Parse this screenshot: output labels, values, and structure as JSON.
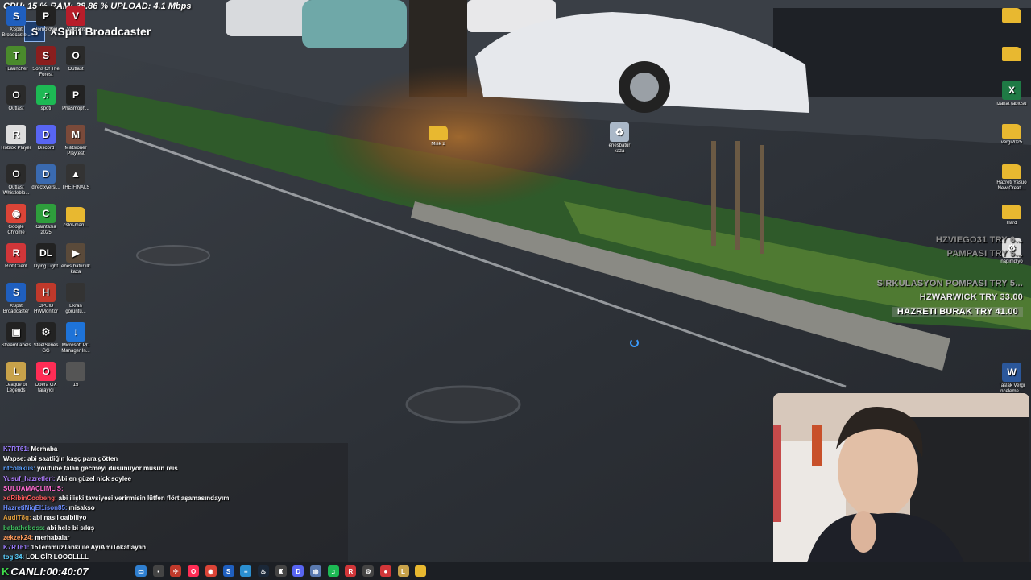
{
  "stats": {
    "text": "CPU: 15 % RAM: 38.86 % UPLOAD: 4.1 Mbps"
  },
  "broadcaster": {
    "logo": "S",
    "title": "XSplit Broadcaster"
  },
  "desktop_icons_left": [
    {
      "label": "XSplit Broadcaste...",
      "icon": "xsplit-icon",
      "color": "#1f5fbf",
      "glyph": "S"
    },
    {
      "label": "Pornofobia",
      "icon": "app-icon",
      "color": "#222222",
      "glyph": "P"
    },
    {
      "label": "Valorant",
      "icon": "valorant-icon",
      "color": "#b81d2a",
      "glyph": "V"
    },
    {
      "label": "TLauncher",
      "icon": "minecraft-icon",
      "color": "#4a8a2c",
      "glyph": "T"
    },
    {
      "label": "Sons Of The Forest",
      "icon": "game-icon",
      "color": "#8a1e1e",
      "glyph": "S"
    },
    {
      "label": "Outlast",
      "icon": "game-icon",
      "color": "#2a2a2a",
      "glyph": "O"
    },
    {
      "label": "Outlast",
      "icon": "game-icon",
      "color": "#2a2a2a",
      "glyph": "O"
    },
    {
      "label": "spoti",
      "icon": "spotify-icon",
      "color": "#1db954",
      "glyph": "♫"
    },
    {
      "label": "Phasmoph...",
      "icon": "phasmophobia-icon",
      "color": "#222222",
      "glyph": "P"
    },
    {
      "label": "Roblox Player",
      "icon": "roblox-icon",
      "color": "#dddddd",
      "glyph": "R"
    },
    {
      "label": "Discord",
      "icon": "discord-icon",
      "color": "#5865f2",
      "glyph": "D"
    },
    {
      "label": "Militsioner Playtest",
      "icon": "game-icon",
      "color": "#7a4a3a",
      "glyph": "M"
    },
    {
      "label": "Outlast Whistleblo...",
      "icon": "game-icon",
      "color": "#2a2a2a",
      "glyph": "O"
    },
    {
      "label": "directxversi...",
      "icon": "directx-icon",
      "color": "#3a6ab0",
      "glyph": "D"
    },
    {
      "label": "THE FINALS",
      "icon": "finals-icon",
      "color": "#333333",
      "glyph": "▲"
    },
    {
      "label": "Google Chrome",
      "icon": "chrome-icon",
      "color": "#db4437",
      "glyph": "◉"
    },
    {
      "label": "Camtasia 2025",
      "icon": "camtasia-icon",
      "color": "#2e9e3c",
      "glyph": "C"
    },
    {
      "label": "cslol-man...",
      "icon": "folder-icon",
      "color": "#e8b830",
      "glyph": ""
    },
    {
      "label": "Riot Client",
      "icon": "riot-icon",
      "color": "#d13639",
      "glyph": "R"
    },
    {
      "label": "Dying Light",
      "icon": "dyinglight-icon",
      "color": "#222222",
      "glyph": "DL"
    },
    {
      "label": "enes batur ilk kaza",
      "icon": "video-icon",
      "color": "#5a4a3a",
      "glyph": "▶"
    },
    {
      "label": "XSplit Broadcaster",
      "icon": "xsplit-icon",
      "color": "#1f5fbf",
      "glyph": "S"
    },
    {
      "label": "CPUID HWMonitor",
      "icon": "hwmonitor-icon",
      "color": "#c0392b",
      "glyph": "H"
    },
    {
      "label": "Ekran görüntü...",
      "icon": "image-icon",
      "color": "#333333",
      "glyph": ""
    },
    {
      "label": "StreamLabels",
      "icon": "streamlabels-icon",
      "color": "#222222",
      "glyph": "▣"
    },
    {
      "label": "SteelSeries GG",
      "icon": "steelseries-icon",
      "color": "#222222",
      "glyph": "⚙"
    },
    {
      "label": "Microsoft PC Manager In...",
      "icon": "download-icon",
      "color": "#1e73d8",
      "glyph": "↓"
    },
    {
      "label": "League of Legends",
      "icon": "lol-icon",
      "color": "#c8a24a",
      "glyph": "L"
    },
    {
      "label": "Opera GX tarayıcı",
      "icon": "opera-icon",
      "color": "#ff2d55",
      "glyph": "O"
    },
    {
      "label": "15",
      "icon": "image-icon",
      "color": "#555555",
      "glyph": ""
    }
  ],
  "desktop_icons_center": [
    {
      "label": "Misk 2",
      "icon": "folder-icon",
      "color": "#e8b830",
      "glyph": ""
    },
    {
      "label": "enesbatur kaza",
      "icon": "recycle-bin-icon",
      "color": "#aab8c8",
      "glyph": "♻"
    }
  ],
  "desktop_icons_right": [
    {
      "label": "",
      "icon": "folder-icon",
      "color": "#e8b830",
      "glyph": ""
    },
    {
      "label": "",
      "icon": "folder-icon",
      "color": "#e8b830",
      "glyph": ""
    },
    {
      "label": "izahat tablosu",
      "icon": "excel-icon",
      "color": "#1f7a45",
      "glyph": "X"
    },
    {
      "label": "vergi2025",
      "icon": "folder-icon",
      "color": "#e8b830",
      "glyph": ""
    },
    {
      "label": "Hazreti Yasuo New Creati...",
      "icon": "folder-icon",
      "color": "#e8b830",
      "glyph": ""
    },
    {
      "label": "Hard",
      "icon": "folder-icon",
      "color": "#e8b830",
      "glyph": ""
    },
    {
      "label": "napimdiyo",
      "icon": "app-icon",
      "color": "#dddddd",
      "glyph": "⚙"
    },
    {
      "label": "Taslak Vergi İnceleme ...",
      "icon": "word-icon",
      "color": "#2b579a",
      "glyph": "W"
    }
  ],
  "donations": [
    {
      "text": "HZVIEGO31 TRY 6...",
      "color": "#8a8a8a"
    },
    {
      "text": "PAMPASI TRY 5...",
      "color": "#8a8a8a"
    },
    {
      "text": "SIRKULASYON POMPASI TRY 5...",
      "color": "#9a9a9a"
    },
    {
      "text": "HZWARWICK TRY 33.00",
      "color": "#e8e8e8"
    },
    {
      "text": "HAZRETI BURAK TRY 41.00",
      "color": "#ffffff"
    }
  ],
  "chat": [
    {
      "user": "K7RT61:",
      "msg": "Merhaba",
      "color": "#9b7cff"
    },
    {
      "user": "Wapse:",
      "msg": "abi saatliğin kaşç para götten",
      "color": "#ffffff"
    },
    {
      "user": "nfcolakus:",
      "msg": "youtube falan gecmeyi dusunuyor musun reis",
      "color": "#5aa0ff"
    },
    {
      "user": "Yusuf_hazretleri:",
      "msg": "Abi en güzel nick soylee",
      "color": "#b07cff"
    },
    {
      "user": "SULUAMAÇLIMLIS:",
      "msg": "",
      "color": "#ff6bd0"
    },
    {
      "user": "xdRibinCoobeng:",
      "msg": "abi ilişki tavsiyesi verirmisin lütfen flört aşamasındayım",
      "color": "#ff5a5a"
    },
    {
      "user": "HazretiNiqEl1ison85:",
      "msg": "misakso",
      "color": "#6b8cff"
    },
    {
      "user": "AudiT8q:",
      "msg": "abi nasıl oalbiliyo",
      "color": "#e0a040"
    },
    {
      "user": "babatheboss:",
      "msg": "abi hele bi sıkış",
      "color": "#40c060"
    },
    {
      "user": "zekzek24:",
      "msg": "merhabalar",
      "color": "#ff9a5a"
    },
    {
      "user": "K7RT61:",
      "msg": "15TemmuzTankı ile AyıAmıTokatlayan",
      "color": "#9b7cff"
    },
    {
      "user": "togi34:",
      "msg": "LOL GİR LOOOLLLL",
      "color": "#5ad0ff"
    }
  ],
  "live": {
    "label": "CANLI:",
    "time": "00:40:07",
    "k": "K"
  },
  "taskbar_icons": [
    {
      "icon": "file-explorer-icon",
      "color": "#2f7fd0",
      "glyph": "▭"
    },
    {
      "icon": "terminal-icon",
      "color": "#444444",
      "glyph": "▪"
    },
    {
      "icon": "app-icon",
      "color": "#c0392b",
      "glyph": "✈"
    },
    {
      "icon": "opera-icon",
      "color": "#ff2d55",
      "glyph": "O"
    },
    {
      "icon": "chrome-icon",
      "color": "#db4437",
      "glyph": "◉"
    },
    {
      "icon": "xsplit-icon",
      "color": "#1f5fbf",
      "glyph": "S"
    },
    {
      "icon": "notes-icon",
      "color": "#2b8fd0",
      "glyph": "≡"
    },
    {
      "icon": "steam-icon",
      "color": "#1b2838",
      "glyph": "♨"
    },
    {
      "icon": "app-icon",
      "color": "#444444",
      "glyph": "♜"
    },
    {
      "icon": "discord-icon",
      "color": "#5865f2",
      "glyph": "D"
    },
    {
      "icon": "app-icon",
      "color": "#5a7ab0",
      "glyph": "◍"
    },
    {
      "icon": "spotify-icon",
      "color": "#1db954",
      "glyph": "♫"
    },
    {
      "icon": "riot-icon",
      "color": "#d13639",
      "glyph": "R"
    },
    {
      "icon": "steelseries-icon",
      "color": "#444444",
      "glyph": "⚙"
    },
    {
      "icon": "record-icon",
      "color": "#d13639",
      "glyph": "●"
    },
    {
      "icon": "lol-icon",
      "color": "#c8a24a",
      "glyph": "L"
    },
    {
      "icon": "folder-icon",
      "color": "#e8b830",
      "glyph": ""
    }
  ]
}
